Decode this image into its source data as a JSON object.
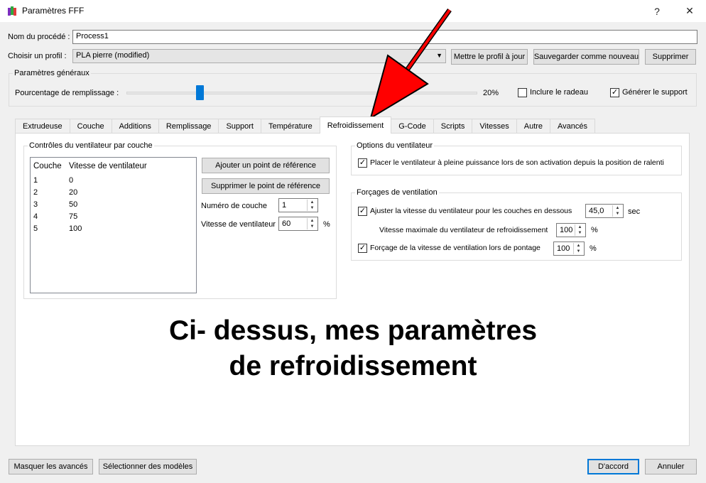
{
  "window": {
    "title": "Paramètres FFF",
    "help_label": "?",
    "close_label": "✕"
  },
  "process": {
    "name_label": "Nom du procédé :",
    "name_value": "Process1"
  },
  "profile": {
    "label": "Choisir un profil :",
    "selected": "PLA pierre (modified)",
    "update_button": "Mettre le profil à jour",
    "save_new_button": "Sauvegarder comme nouveau",
    "delete_button": "Supprimer"
  },
  "general": {
    "title": "Paramètres généraux",
    "infill_label": "Pourcentage de remplissage :",
    "infill_value": "20%",
    "infill_fraction": 0.2,
    "raft_label": "Inclure le radeau",
    "raft_checked": false,
    "support_label": "Générer le support",
    "support_checked": true
  },
  "tabs": [
    {
      "label": "Extrudeuse",
      "active": false
    },
    {
      "label": "Couche",
      "active": false
    },
    {
      "label": "Additions",
      "active": false
    },
    {
      "label": "Remplissage",
      "active": false
    },
    {
      "label": "Support",
      "active": false
    },
    {
      "label": "Température",
      "active": false
    },
    {
      "label": "Refroidissement",
      "active": true
    },
    {
      "label": "G-Code",
      "active": false
    },
    {
      "label": "Scripts",
      "active": false
    },
    {
      "label": "Vitesses",
      "active": false
    },
    {
      "label": "Autre",
      "active": false
    },
    {
      "label": "Avancés",
      "active": false
    }
  ],
  "fan_layer": {
    "title": "Contrôles du ventilateur par couche",
    "col_layer": "Couche",
    "col_speed": "Vitesse de ventilateur",
    "rows": [
      {
        "layer": "1",
        "speed": "0"
      },
      {
        "layer": "2",
        "speed": "20"
      },
      {
        "layer": "3",
        "speed": "50"
      },
      {
        "layer": "4",
        "speed": "75"
      },
      {
        "layer": "5",
        "speed": "100"
      }
    ],
    "add_button": "Ajouter un point de référence",
    "remove_button": "Supprimer le point de référence",
    "layer_num_label": "Numéro de couche",
    "layer_num_value": "1",
    "fan_speed_label": "Vitesse de ventilateur",
    "fan_speed_value": "60",
    "fan_speed_unit": "%"
  },
  "fan_options": {
    "title": "Options du ventilateur",
    "full_power_label": "Placer le ventilateur à pleine puissance lors de son activation depuis la position de ralenti",
    "full_power_checked": true
  },
  "overrides": {
    "title": "Forçages de ventilation",
    "adjust_label": "Ajuster la vitesse du ventilateur pour les couches en dessous",
    "adjust_checked": true,
    "adjust_value": "45,0",
    "adjust_unit": "sec",
    "max_speed_label": "Vitesse maximale du ventilateur de refroidissement",
    "max_speed_value": "100",
    "max_speed_unit": "%",
    "bridge_label": "Forçage de la vitesse de ventilation lors de pontage",
    "bridge_checked": true,
    "bridge_value": "100",
    "bridge_unit": "%"
  },
  "caption": {
    "line1": "Ci- dessus, mes paramètres",
    "line2": "de refroidissement"
  },
  "footer": {
    "hide_advanced": "Masquer les avancés",
    "select_models": "Sélectionner des modèles",
    "ok": "D'accord",
    "cancel": "Annuler"
  },
  "colors": {
    "accent": "#0078d7",
    "arrow": "#ff0000"
  }
}
